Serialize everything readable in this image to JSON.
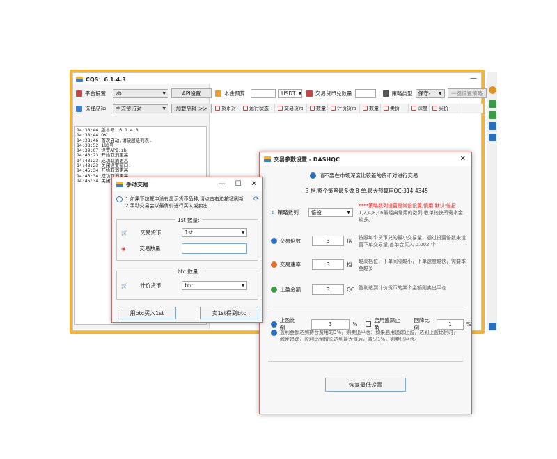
{
  "main": {
    "title": "CQS：6.1.4.3",
    "platform_label": "平台设置",
    "platform_value": "zb",
    "api_button": "API设置",
    "pair_label": "选择品种",
    "pair_value": "主流货币对",
    "load_button": "加载品种 >>",
    "capital_label": "本金预算",
    "capital_unit": "USDT",
    "count_label": "交易货币兑数量",
    "strategy_type_label": "策略类型",
    "strategy_type_value": "保守-",
    "one_key_button": "一键设置策略",
    "columns": [
      "货币对",
      "运行状态",
      "交易货币",
      "数量",
      "计价货币",
      "数量",
      "卖价",
      "深度",
      "买价"
    ],
    "log": [
      "14:38:44 版本号：6.1.4.3",
      "14:38:44 OK",
      "14:38:46 首次启动,请缺超级列表.",
      "14:38:52 180号",
      "14:39:07 设置API:zb",
      "14:43:23 开始取消更高",
      "14:43:23 成功取消更高",
      "14:43:23 关闭设置窗口.",
      "14:45:34 开始取消更高",
      "14:45:34 成功取消更高",
      "14:45:34 关闭设置窗口."
    ]
  },
  "manual_trade": {
    "title": "手动交易",
    "info_line1": "1.如果下拉框中没有显示货币品种,请点击右边按钮刷新.",
    "info_line2": "2.手动交易会以最优价进行买入或卖出.",
    "group1_label": "1st 数量:",
    "currency_label": "交易货币",
    "currency_value": "1st",
    "amount_label": "交易数量",
    "amount_value": "",
    "group2_label": "btc 数量:",
    "quote_label": "计价货币",
    "quote_value": "btc",
    "buy_button": "用btc买入1st",
    "sell_button": "卖1st得到btc"
  },
  "params": {
    "title": "交易参数设置 - DASHQC",
    "notice": "请不要在市场深度比较差的货币对进行交易",
    "summary": "3 档,整个策略最多做 8 单,最大预算用QC:314.4345",
    "seq_label": "策略数列",
    "seq_value": "倍投",
    "seq_desc_red": "****策略数列设置是常设设置,慎用,默认:倍投.",
    "seq_desc": "1,2,4,8,16最经典常用的数列,收单较快所需本金较多。",
    "mult_label": "交易倍数",
    "mult_value": "3",
    "mult_unit": "倍",
    "mult_desc": "按照每个货币兑的最小交易量，通过设置倍数来设置下单交易量,首单会买入 0.002 个",
    "speed_label": "交易速率",
    "speed_value": "3",
    "speed_unit": "档",
    "speed_desc": "越高档位，下单间隔越小，下单速度越快，需要本金越多",
    "stop_label": "止盈金额",
    "stop_value": "3",
    "stop_unit": "QC",
    "stop_desc": "盈利达到计价货币的某个金额则卖出平仓",
    "ratio_label": "止盈比例",
    "ratio_value": "3",
    "ratio_unit": "%",
    "trailing_label": "启用追踪止盈",
    "pullback_label": "回降比例",
    "pullback_value": "1",
    "pullback_unit": "%",
    "ratio_desc": "盈利金额达到持仓费用的3%，则卖出平仓；如果启用追踪止盈，达到止盈比例时，触发追踪，盈利比例增长达到最大值后，减少1%，则卖出平仓。",
    "reset_button": "恢复最低设置"
  },
  "colors": {
    "frame": "#f0b43a",
    "dialog_border": "#c46b6b",
    "accent_blue": "#3b7fd0"
  }
}
